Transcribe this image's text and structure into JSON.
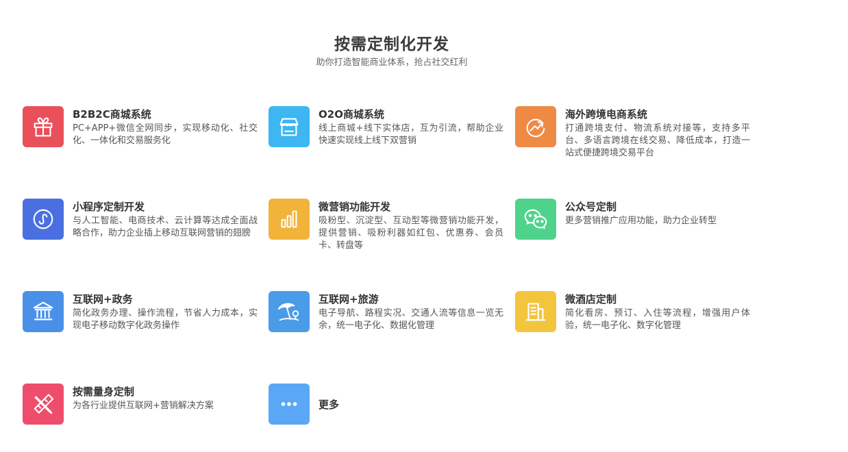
{
  "header": {
    "title": "按需定制化开发",
    "subtitle": "助你打造智能商业体系，抢占社交红利"
  },
  "items": [
    {
      "title": "B2B2C商城系统",
      "desc": "PC+APP+微信全网同步，实现移动化、社交化、一体化和交易服务化",
      "icon": "gift-icon",
      "color": "#e9505a"
    },
    {
      "title": "O2O商城系统",
      "desc": "线上商城+线下实体店，互为引流，帮助企业快速实现线上线下双营销",
      "icon": "storefront-icon",
      "color": "#3db6f2"
    },
    {
      "title": "海外跨境电商系统",
      "desc": "打通跨境支付、物流系统对接等，支持多平台、多语言跨境在线交易、降低成本，打造一站式便捷跨境交易平台",
      "icon": "trend-arrow-icon",
      "color": "#ef8a45"
    },
    {
      "title": "小程序定制开发",
      "desc": "与人工智能、电商技术、云计算等达成全面战略合作，助力企业插上移动互联网营销的翅膀",
      "icon": "mini-program-icon",
      "color": "#4a6fe0"
    },
    {
      "title": "微营销功能开发",
      "desc": "吸粉型、沉淀型、互动型等微营销功能开发，提供营销、吸粉利器如红包、优惠券、会员卡、转盘等",
      "icon": "bar-chart-icon",
      "color": "#f2b33a"
    },
    {
      "title": "公众号定制",
      "desc": "更多营销推广应用功能，助力企业转型",
      "icon": "wechat-icon",
      "color": "#4fd38c"
    },
    {
      "title": "互联网+政务",
      "desc": "简化政务办理、操作流程，节省人力成本，实现电子移动数字化政务操作",
      "icon": "government-building-icon",
      "color": "#4a90e8"
    },
    {
      "title": "互联网+旅游",
      "desc": "电子导航、路程实况、交通人流等信息一览无余，统一电子化、数据化管理",
      "icon": "beach-umbrella-icon",
      "color": "#4a9be8"
    },
    {
      "title": "微酒店定制",
      "desc": "简化看房、预订、入住等流程，增强用户体验，统一电子化、数字化管理",
      "icon": "hotel-building-icon",
      "color": "#f2c53c"
    },
    {
      "title": "按需量身定制",
      "desc": "为各行业提供互联网+营销解决方案",
      "icon": "pencil-ruler-icon",
      "color": "#ee4d6c"
    },
    {
      "title": "更多",
      "desc": "",
      "icon": "more-dots-icon",
      "color": "#5aa8f5"
    }
  ]
}
